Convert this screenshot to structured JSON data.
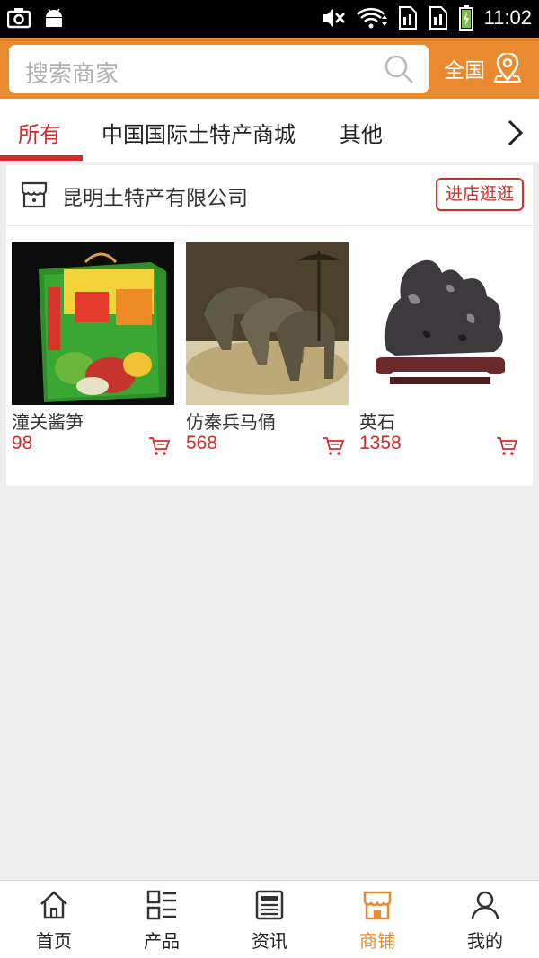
{
  "status_bar": {
    "time": "11:02"
  },
  "header": {
    "search_placeholder": "搜索商家",
    "region_label": "全国"
  },
  "tabs": [
    {
      "label": "所有",
      "active": true
    },
    {
      "label": "中国国际土特产商城",
      "active": false
    },
    {
      "label": "其他",
      "active": false
    }
  ],
  "shop": {
    "name": "昆明土特产有限公司",
    "visit_label": "进店逛逛",
    "products": [
      {
        "name": "潼关酱笋",
        "price": "98"
      },
      {
        "name": "仿秦兵马俑",
        "price": "568"
      },
      {
        "name": "英石",
        "price": "1358"
      }
    ]
  },
  "bottom_nav": [
    {
      "label": "首页",
      "icon": "home-icon",
      "active": false
    },
    {
      "label": "产品",
      "icon": "grid-list-icon",
      "active": false
    },
    {
      "label": "资讯",
      "icon": "news-icon",
      "active": false
    },
    {
      "label": "商铺",
      "icon": "store-icon",
      "active": true
    },
    {
      "label": "我的",
      "icon": "user-icon",
      "active": false
    }
  ],
  "colors": {
    "accent_orange": "#e98a31",
    "accent_red": "#d92a2a",
    "page_background": "#efefef"
  }
}
